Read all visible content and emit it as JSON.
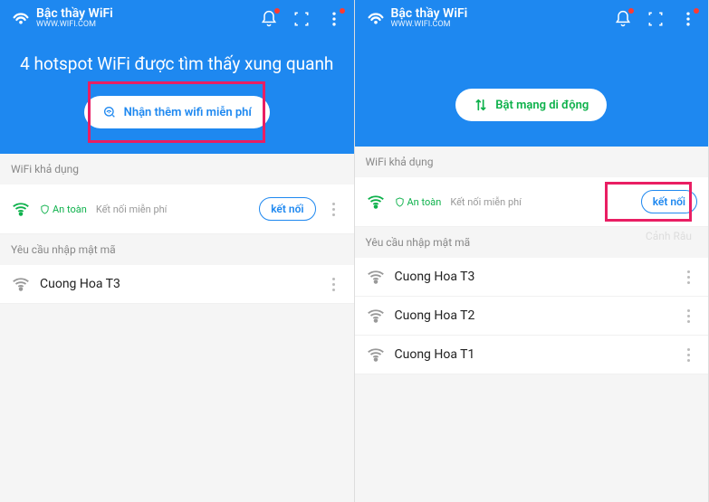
{
  "header": {
    "title": "Bậc thầy WiFi",
    "subtitle": "WWW.WIFI.COM"
  },
  "left": {
    "hero": "4 hotspot WiFi được tìm thấy xung quanh",
    "pill_label": "Nhận thêm wifi miễn phí",
    "available_label": "WiFi khả dụng",
    "safe_label": "An toàn",
    "free_label": "Kết nối miễn phí",
    "connect_label": "kết nối",
    "password_label": "Yêu cầu nhập mật mã",
    "networks": [
      "Cuong Hoa T3"
    ]
  },
  "right": {
    "pill_label": "Bật mạng di động",
    "available_label": "WiFi khả dụng",
    "safe_label": "An toàn",
    "free_label": "Kết nối miễn phí",
    "connect_label": "kết nối",
    "password_label": "Yêu cầu nhập mật mã",
    "networks": [
      "Cuong Hoa T3",
      "Cuong Hoa T2",
      "Cuong Hoa T1"
    ],
    "watermark": "Cảnh Râu"
  }
}
